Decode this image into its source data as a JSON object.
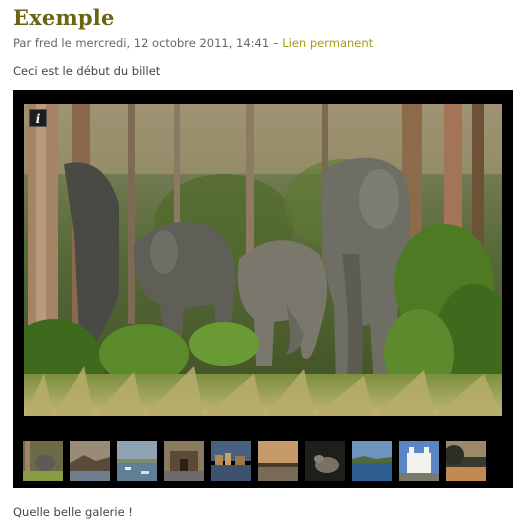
{
  "post": {
    "title": "Exemple",
    "meta_prefix": "Par fred le mercredi, 12 octobre 2011, 14:41",
    "meta_sep": " – ",
    "permalink_label": "Lien permanent",
    "intro": "Ceci est le début du billet",
    "outro": "Quelle belle galerie !"
  },
  "gallery": {
    "info_label": "i",
    "main_image": "elephants-in-forest-photo",
    "thumbnails": [
      "elephants-thumbnail",
      "coastal-hills-thumbnail",
      "bay-with-boats-thumbnail",
      "gateway-monument-thumbnail",
      "harbor-town-thumbnail",
      "sunset-waterfront-thumbnail",
      "dark-animal-thumbnail",
      "blue-bay-thumbnail",
      "white-church-thumbnail",
      "cliff-sea-thumbnail"
    ]
  },
  "colors": {
    "title": "#6b6510",
    "link": "#a59b13",
    "gallery_bg": "#000000"
  }
}
